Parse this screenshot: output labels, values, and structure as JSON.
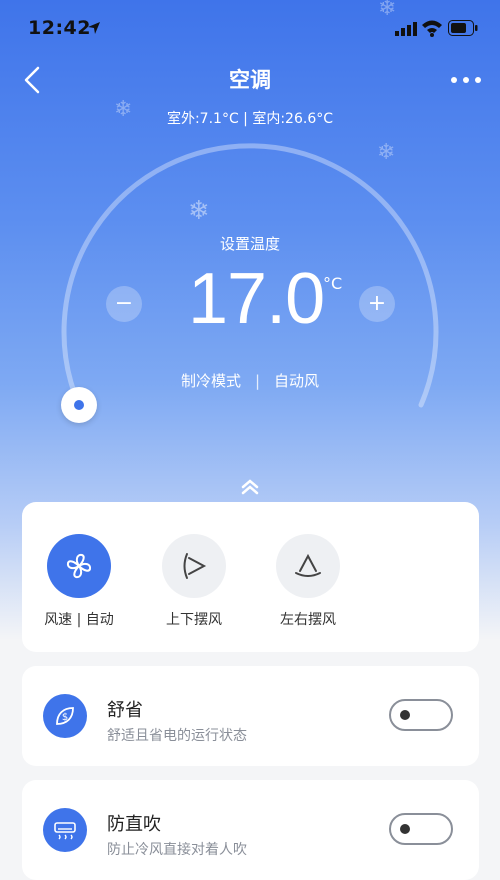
{
  "status_bar": {
    "time": "12:42"
  },
  "header": {
    "title": "空调",
    "env_info": "室外:7.1°C | 室内:26.6°C"
  },
  "thermostat": {
    "label": "设置温度",
    "temperature": "17.0",
    "unit": "°C",
    "decrease": "−",
    "increase": "+",
    "mode": "制冷模式",
    "separator": "|",
    "fan": "自动风"
  },
  "controls": [
    {
      "label": "风速 | 自动",
      "icon": "fan-icon",
      "active": true
    },
    {
      "label": "上下摆风",
      "icon": "vertical-swing-icon",
      "active": false
    },
    {
      "label": "左右摆风",
      "icon": "horizontal-swing-icon",
      "active": false
    }
  ],
  "features": [
    {
      "title": "舒省",
      "desc": "舒适且省电的运行状态",
      "icon": "eco-leaf-icon",
      "enabled": false
    },
    {
      "title": "防直吹",
      "desc": "防止冷风直接对着人吹",
      "icon": "ac-unit-icon",
      "enabled": false
    }
  ],
  "colors": {
    "accent": "#3f74ea",
    "card": "#ffffff",
    "text_secondary": "#8a8f99"
  }
}
